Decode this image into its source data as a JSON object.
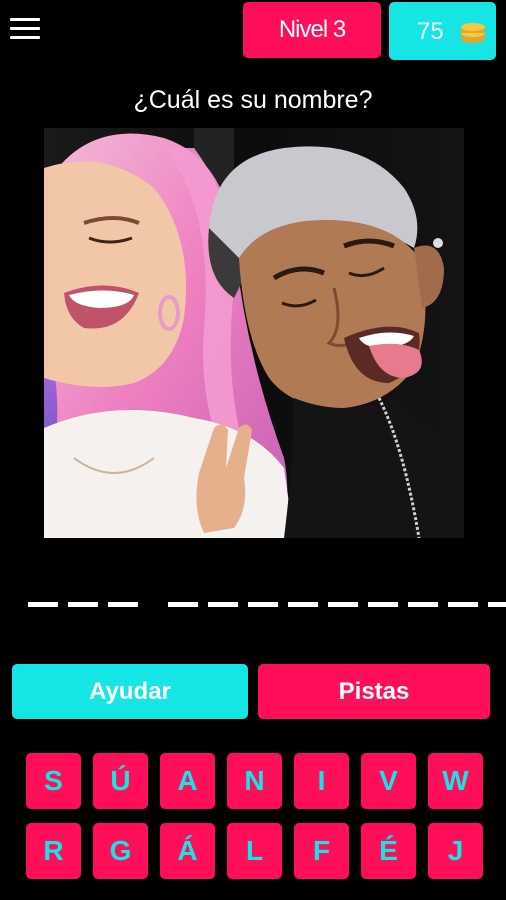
{
  "colors": {
    "pink": "#FF0F5A",
    "cyan": "#15E5E5",
    "gold": "#F6C842",
    "background": "#000000",
    "text": "#FFFFFF"
  },
  "header": {
    "menu_icon": "hamburger-menu-icon",
    "level_label": "Nivel 3",
    "coins_count": "75",
    "coins_icon": "coin-stack-icon"
  },
  "question": {
    "text": "¿Cuál es su nombre?"
  },
  "answer": {
    "words": [
      3,
      9
    ]
  },
  "actions": {
    "help_label": "Ayudar",
    "hints_label": "Pistas"
  },
  "keyboard": {
    "row1": [
      "S",
      "Ú",
      "A",
      "N",
      "I",
      "V",
      "W"
    ],
    "row2": [
      "R",
      "G",
      "Á",
      "L",
      "F",
      "É",
      "J"
    ]
  }
}
